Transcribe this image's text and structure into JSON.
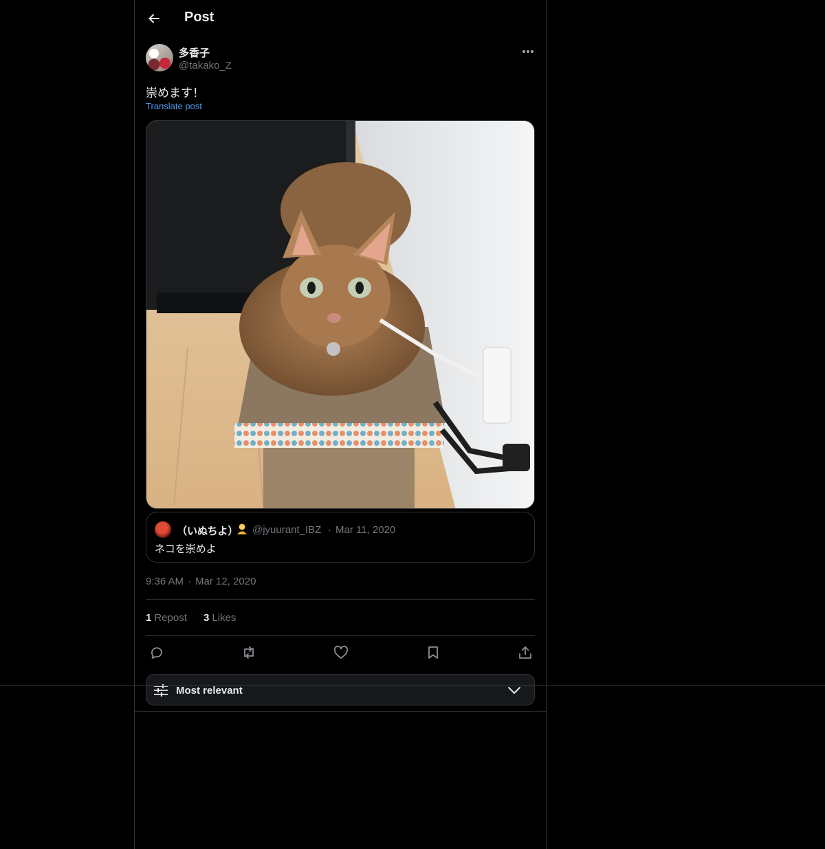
{
  "header": {
    "title": "Post",
    "back_icon": "arrow-left-icon"
  },
  "post": {
    "author": {
      "name": "多香子",
      "handle": "@takako_Z"
    },
    "text": "崇めます！",
    "translate_label": "Translate post",
    "timestamp": {
      "time": "9:36 AM",
      "separator": "·",
      "date": "Mar 12, 2020"
    },
    "stats": {
      "reposts_count": "1",
      "reposts_label": "Repost",
      "likes_count": "3",
      "likes_label": "Likes"
    }
  },
  "quote": {
    "name": "（いぬちよ）",
    "emoji_icon": "person-emoji-icon",
    "handle": "@jyuurant_IBZ",
    "separator": "·",
    "date": "Mar 11, 2020",
    "text": "ネコを崇めよ"
  },
  "sort": {
    "label": "Most relevant"
  },
  "colors": {
    "background": "#000000",
    "text": "#e7e9ea",
    "muted": "#71767b",
    "link": "#4a99e9",
    "border": "#2f3336"
  }
}
